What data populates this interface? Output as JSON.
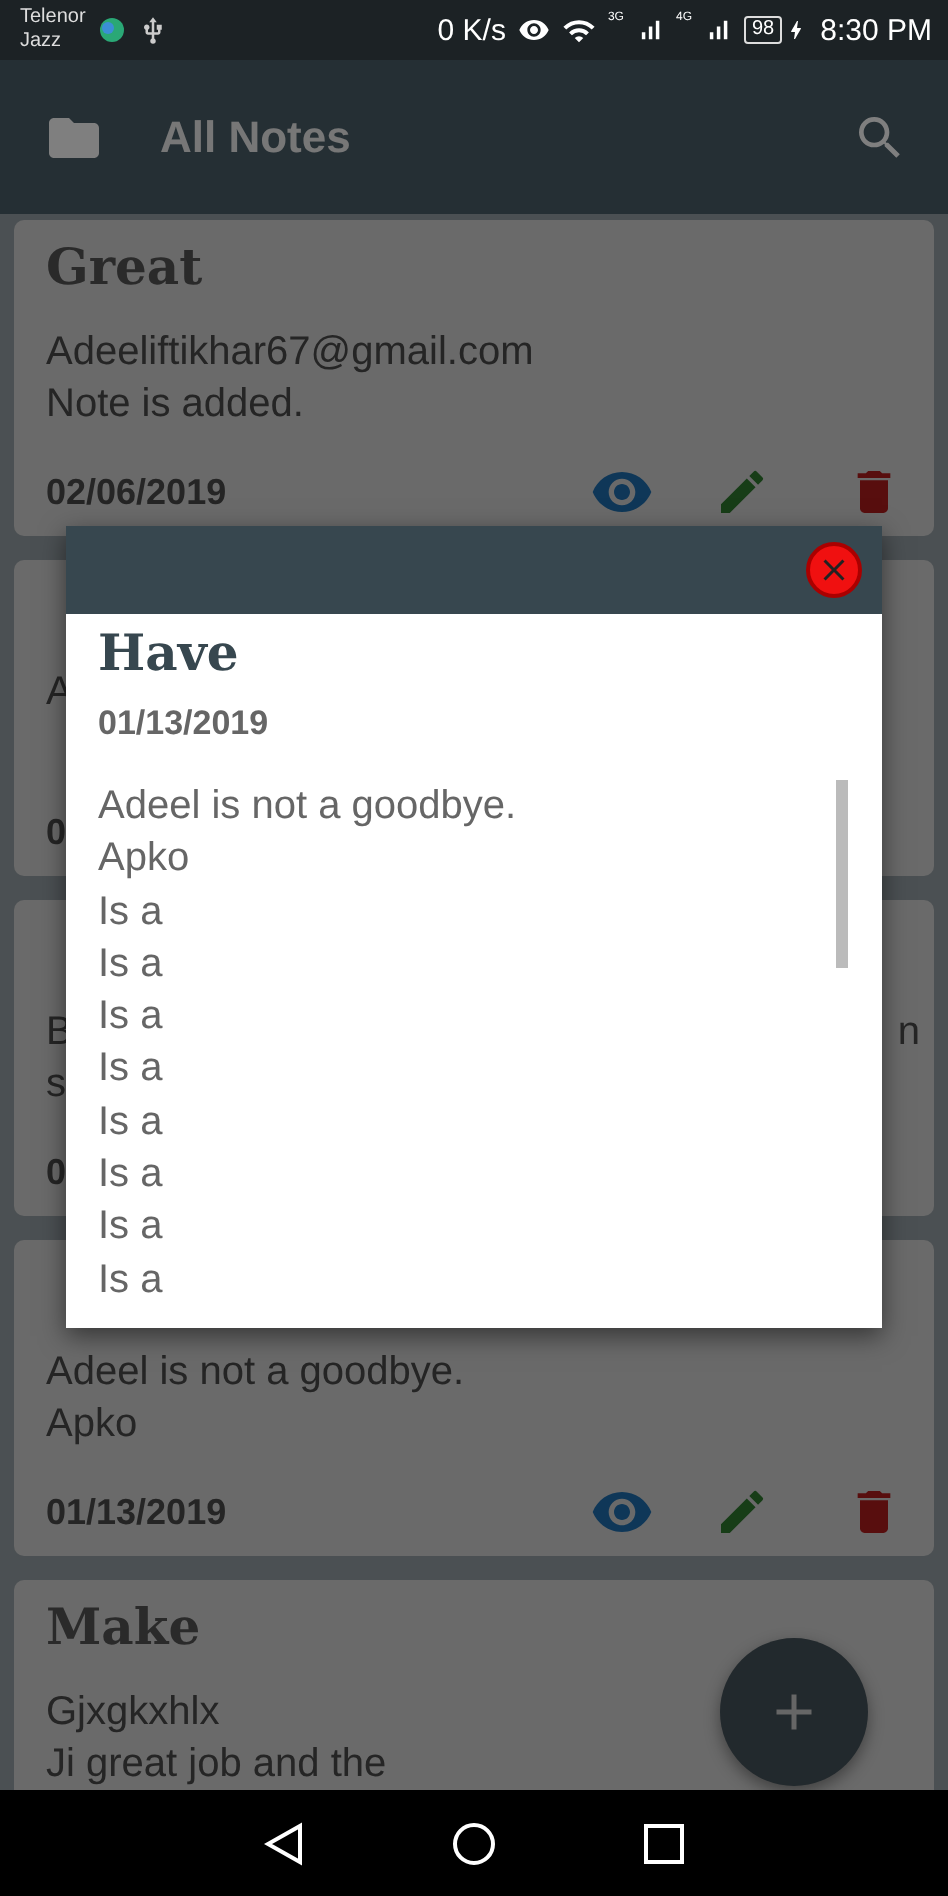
{
  "status_bar": {
    "carrier": [
      "Telenor",
      "Jazz"
    ],
    "net_speed": "0 K/s",
    "networks": [
      "3G",
      "4G"
    ],
    "battery": "98",
    "time": "8:30 PM"
  },
  "app_bar": {
    "title": "All Notes"
  },
  "notes": [
    {
      "title": "Great",
      "body": [
        "Adeeliftikhar67@gmail.com",
        "Note is added."
      ],
      "date": "02/06/2019",
      "actions": [
        {
          "kind": "view"
        },
        {
          "kind": "edit"
        },
        {
          "kind": "delete"
        }
      ]
    },
    {
      "body": [
        "A"
      ],
      "date": "0"
    },
    {
      "body": [
        "B",
        "s"
      ],
      "body_end": "n",
      "date": "0"
    },
    {
      "body": [
        "Adeel is not a goodbye.",
        "Apko"
      ],
      "date": "01/13/2019",
      "actions": [
        {
          "kind": "view"
        },
        {
          "kind": "edit"
        },
        {
          "kind": "delete"
        }
      ]
    },
    {
      "title": "Make",
      "body": [
        "Gjxgkxhlx",
        "Ji great job and the"
      ]
    }
  ],
  "dialog": {
    "title": "Have",
    "date": "01/13/2019",
    "lines": [
      "Adeel is not a goodbye.",
      "Apko",
      "Is a",
      "Is a",
      "Is a",
      "Is a",
      "Is a",
      "Is a",
      "Is a",
      "Is a"
    ]
  }
}
